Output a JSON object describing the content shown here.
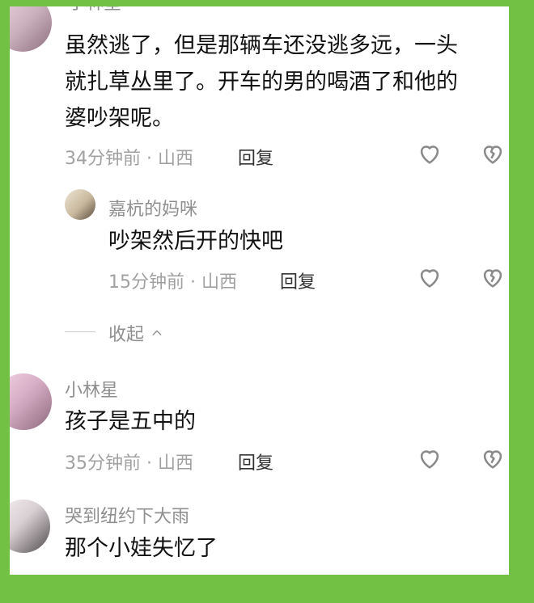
{
  "top_partial": {
    "name": "小林星"
  },
  "comment1": {
    "lines": [
      "虽然逃了，但是那辆车还没逃多远，一头",
      "就扎草丛里了。开车的男的喝酒了和他的",
      "婆吵架呢。"
    ],
    "meta": "34分钟前 · 山西",
    "reply": "回复"
  },
  "reply1": {
    "name": "嘉杭的妈咪",
    "text": "吵架然后开的快吧",
    "meta": "15分钟前 · 山西",
    "reply": "回复"
  },
  "collapse": {
    "label": "收起"
  },
  "comment2": {
    "name": "小林星",
    "text": "孩子是五中的",
    "meta": "35分钟前 · 山西",
    "reply": "回复"
  },
  "comment3": {
    "name": "哭到纽约下大雨",
    "text": "那个小娃失忆了"
  },
  "icons": {
    "like": "heart-outline-icon",
    "dislike": "broken-heart-icon",
    "collapse": "chevron-up-icon"
  },
  "colors": {
    "frame": "#72c145",
    "text_primary": "#111111",
    "text_secondary": "#8f8f8f"
  }
}
